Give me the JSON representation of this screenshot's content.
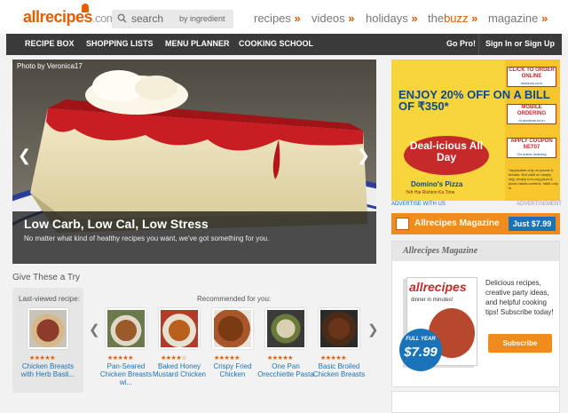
{
  "header": {
    "logo_main": "allrecipes",
    "logo_suffix": ".com",
    "search_placeholder": "search",
    "search_mode": "by ingredient",
    "nav": [
      {
        "label": "recipes",
        "arrow": "»"
      },
      {
        "label": "videos",
        "arrow": "»"
      },
      {
        "label": "holidays",
        "arrow": "»"
      },
      {
        "label_a": "the",
        "label_b": "buzz",
        "arrow": "»"
      },
      {
        "label": "magazine",
        "arrow": "»"
      }
    ]
  },
  "navbar": {
    "items": [
      "RECIPE BOX",
      "SHOPPING LISTS",
      "MENU PLANNER",
      "COOKING SCHOOL"
    ],
    "go_pro": "Go Pro!",
    "signin": "Sign In or Sign Up"
  },
  "hero": {
    "credit": "Photo by Veronica17",
    "title": "Low Carb, Low Cal, Low Stress",
    "subtitle": "No matter what kind of healthy recipes you want, we've got something for you."
  },
  "try": {
    "title": "Give These a Try",
    "last_viewed_label": "Last-viewed recipe:",
    "recommended_label": "Recommended for you:",
    "last_viewed": {
      "name": "Chicken Breasts with Herb Basti...",
      "stars": "★★★★★"
    },
    "recipes": [
      {
        "name": "Pan-Seared Chicken Breasts wi...",
        "stars": "★★★★★"
      },
      {
        "name": "Baked Honey Mustard Chicken",
        "stars": "★★★★☆"
      },
      {
        "name": "Crispy Fried Chicken",
        "stars": "★★★★★"
      },
      {
        "name": "One Pan Orecchiette Pasta",
        "stars": "★★★★★"
      },
      {
        "name": "Basic Broiled Chicken Breasts",
        "stars": "★★★★★"
      }
    ]
  },
  "ad": {
    "offer": "ENJOY 20% OFF ON A BILL OF ₹350*",
    "deal": "Deal-icious All Day",
    "brand": "Domino's Pizza",
    "tagline": "Yeh Hai Rishton Ka Time",
    "boxes": [
      {
        "title": "CLICK TO ORDER ONLINE",
        "sub": "dominos.co.in"
      },
      {
        "title": "MOBILE ORDERING",
        "sub": "m.dominos.co.in"
      },
      {
        "title": "APPLY COUPON NET07",
        "sub": "On online ordering"
      }
    ],
    "note": "*Applicable only on pizzas & breads. Not valid on simply veg, simply non-veg pizza & pizza mania combos. Valid only in",
    "advertise_label": "ADVERTISE WITH US",
    "advertisement_label": "ADVERTISEMENT"
  },
  "magazine": {
    "bar_title": "Allrecipes Magazine",
    "bar_price": "Just $7.99",
    "panel_title": "Allrecipes Magazine",
    "cover_title": "allrecipes",
    "cover_sub": "dinner in minutes!",
    "badge_year": "FULL YEAR",
    "badge_price": "$7.99",
    "description": "Delicious recipes, creative party ideas, and helpful cooking tips! Subscribe today!",
    "subscribe": "Subscribe"
  },
  "colors": {
    "accent": "#e65c00",
    "navbar": "#3a3a3a",
    "link": "#1a73b8",
    "orange": "#f08c1e"
  }
}
